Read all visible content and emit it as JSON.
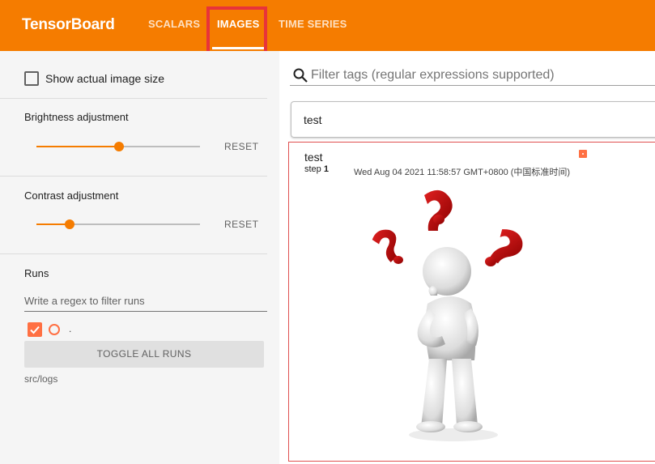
{
  "header": {
    "brand": "TensorBoard",
    "tabs": [
      {
        "label": "SCALARS",
        "active": false
      },
      {
        "label": "IMAGES",
        "active": true
      },
      {
        "label": "TIME SERIES",
        "active": false
      }
    ],
    "accent_color": "#f57c00"
  },
  "sidebar": {
    "show_actual_size": {
      "label": "Show actual image size",
      "checked": false
    },
    "brightness": {
      "label": "Brightness adjustment",
      "reset_label": "RESET",
      "level": 0.5
    },
    "contrast": {
      "label": "Contrast adjustment",
      "reset_label": "RESET",
      "level": 0.2
    },
    "runs": {
      "title": "Runs",
      "filter_placeholder": "Write a regex to filter runs",
      "run_name": ".",
      "run_color": "#ff7043",
      "toggle_label": "TOGGLE ALL RUNS",
      "log_dir": "src/logs"
    }
  },
  "main": {
    "filter_placeholder": "Filter tags (regular expressions supported)",
    "tag_group": "test",
    "card": {
      "title": "test",
      "step_label": "step",
      "step_value": "1",
      "timestamp": "Wed Aug 04 2021 11:58:57 GMT+0800 (中国标准时间)"
    }
  }
}
